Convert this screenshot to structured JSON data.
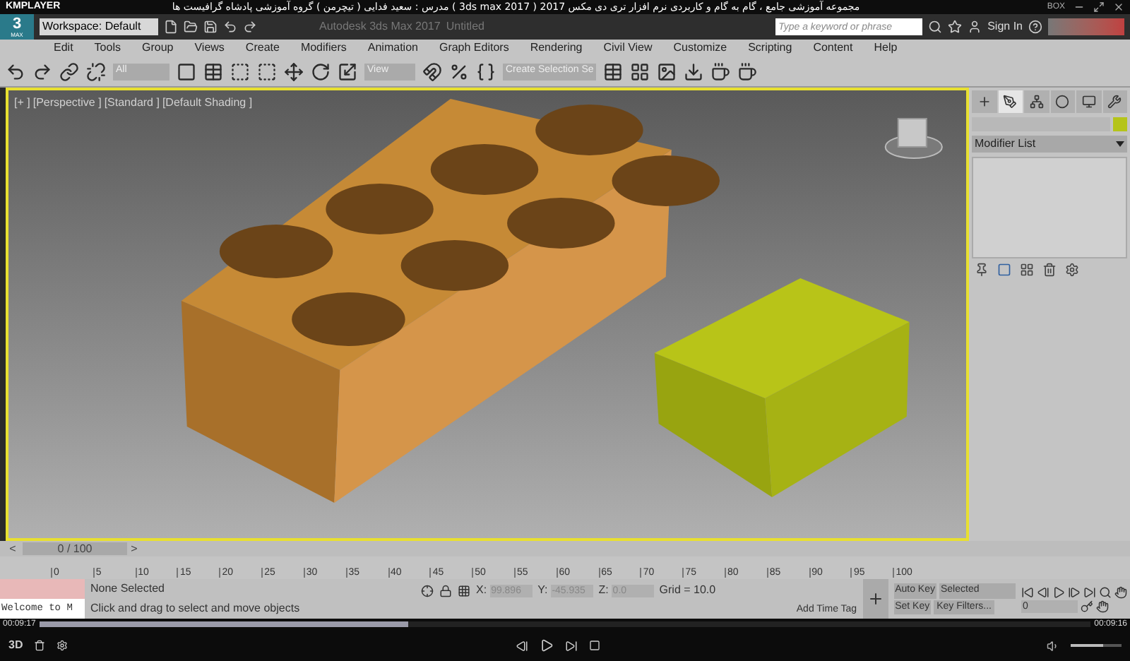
{
  "player": {
    "brand": "KMPLAYER",
    "title": "مجموعه آموزشی جامع ، گام به گام و کاربردی نرم افزار تری دی مکس 2017 ( 3ds max 2017 ) مدرس : سعید فدایی ( تیچرمن ) گروه آموزشی پادشاه گرافیست ها",
    "badge": "BOX"
  },
  "max_titlebar": {
    "logo": "3",
    "logo_sub": "MAX",
    "workspace": "Workspace: Default",
    "app_title": "Autodesk 3ds Max 2017",
    "document": "Untitled",
    "search": {
      "placeholder": "Type a keyword or phrase"
    },
    "sign_in": "Sign In"
  },
  "menu": [
    "Edit",
    "Tools",
    "Group",
    "Views",
    "Create",
    "Modifiers",
    "Animation",
    "Graph Editors",
    "Rendering",
    "Civil View",
    "Customize",
    "Scripting",
    "Content",
    "Help"
  ],
  "toolbar": {
    "selection_filter": "All",
    "reference_coord": "View",
    "named_selection": "Create Selection Se"
  },
  "viewport": {
    "active": true,
    "labels": [
      "[+ ]",
      "[Perspective ]",
      "[Standard ]",
      "[Default Shading ]"
    ]
  },
  "command_panel": {
    "tabs": [
      {
        "kind": "create",
        "selected": false
      },
      {
        "kind": "modify",
        "selected": true
      },
      {
        "kind": "hierarchy",
        "selected": false
      },
      {
        "kind": "motion",
        "selected": false
      },
      {
        "kind": "display",
        "selected": false
      },
      {
        "kind": "utilities",
        "selected": false
      }
    ],
    "modifier_list": "Modifier List"
  },
  "time_slider": {
    "prev": "<",
    "label": "0 / 100",
    "next": ">",
    "level": 0
  },
  "trackbar": {
    "ticks": [
      "0",
      "5",
      "10",
      "15",
      "20",
      "25",
      "30",
      "35",
      "40",
      "45",
      "50",
      "55",
      "60",
      "65",
      "70",
      "75",
      "80",
      "85",
      "90",
      "95",
      "100"
    ]
  },
  "status": {
    "listener": "Welcome to M",
    "selection": "None Selected",
    "prompt": "Click and drag to select and move objects",
    "coords": [
      {
        "label": "X:",
        "value": "99.896"
      },
      {
        "label": "Y:",
        "value": "-45.935"
      },
      {
        "label": "Z:",
        "value": "0.0"
      }
    ],
    "grid": "Grid = 10.0",
    "time_tag": "Add Time Tag",
    "auto_key": "Auto Key",
    "key_mode": "Selected",
    "set_key": "Set Key",
    "key_filters": "Key Filters...",
    "frame": "0"
  },
  "playback": {
    "elapsed": "00:09:17",
    "total": "00:09:16",
    "level": 0.35,
    "volume": {
      "level": 0.65
    },
    "button_3d": "3D"
  }
}
